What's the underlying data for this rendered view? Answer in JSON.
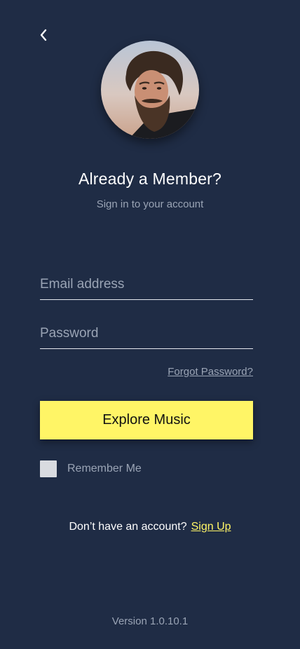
{
  "header": {
    "back_icon": "chevron-left-icon"
  },
  "profile": {
    "avatar": "profile-photo"
  },
  "heading": {
    "title": "Already a Member?",
    "subtitle": "Sign in to your account"
  },
  "form": {
    "email_placeholder": "Email address",
    "email_value": "",
    "password_placeholder": "Password",
    "password_value": "",
    "forgot_label": "Forgot Password?",
    "submit_label": "Explore Music",
    "remember_label": "Remember Me",
    "remember_checked": false
  },
  "signup": {
    "prompt": "Don’t have an account?",
    "link_label": "Sign Up"
  },
  "footer": {
    "version": "Version 1.0.10.1"
  },
  "colors": {
    "background": "#1f2c45",
    "accent": "#fff566",
    "muted_text": "#9aa4b5",
    "field_line": "#e6e9ef"
  }
}
